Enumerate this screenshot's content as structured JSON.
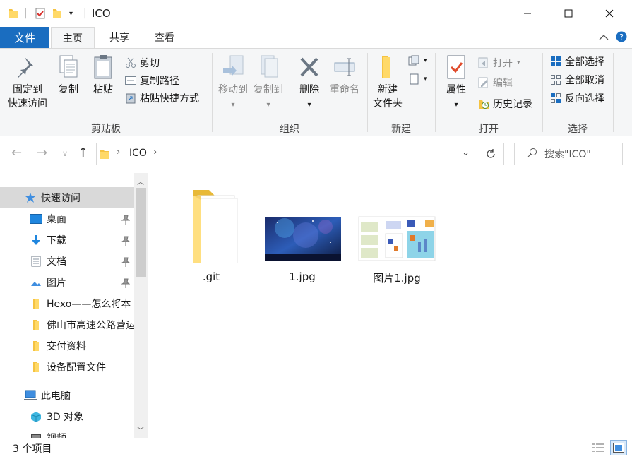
{
  "window": {
    "title": "ICO"
  },
  "ribbon_tabs": [
    "文件",
    "主页",
    "共享",
    "查看"
  ],
  "ribbon": {
    "clipboard": {
      "pin_label_1": "固定到",
      "pin_label_2": "快速访问",
      "copy": "复制",
      "paste": "粘贴",
      "cut": "剪切",
      "copy_path": "复制路径",
      "paste_shortcut": "粘贴快捷方式",
      "group": "剪贴板"
    },
    "organize": {
      "move_to": "移动到",
      "copy_to": "复制到",
      "delete": "删除",
      "rename": "重命名",
      "group": "组织"
    },
    "new": {
      "new_folder_1": "新建",
      "new_folder_2": "文件夹",
      "group": "新建"
    },
    "open": {
      "properties": "属性",
      "open": "打开",
      "edit": "编辑",
      "history": "历史记录",
      "group": "打开"
    },
    "select": {
      "select_all": "全部选择",
      "select_none": "全部取消",
      "invert": "反向选择",
      "group": "选择"
    }
  },
  "address": {
    "path": "ICO",
    "search_placeholder": "搜索\"ICO\""
  },
  "nav_pane": {
    "quick_access": "快速访问",
    "items": [
      {
        "label": "桌面",
        "pinned": true
      },
      {
        "label": "下载",
        "pinned": true
      },
      {
        "label": "文档",
        "pinned": true
      },
      {
        "label": "图片",
        "pinned": true
      },
      {
        "label": "Hexo——怎么将本",
        "pinned": false
      },
      {
        "label": "佛山市高速公路营运",
        "pinned": false
      },
      {
        "label": "交付资料",
        "pinned": false
      },
      {
        "label": "设备配置文件",
        "pinned": false
      }
    ],
    "this_pc": "此电脑",
    "pc_items": [
      "3D 对象",
      "视频"
    ]
  },
  "files": [
    {
      "name": ".git",
      "kind": "folder"
    },
    {
      "name": "1.jpg",
      "kind": "image-space"
    },
    {
      "name": "图片1.jpg",
      "kind": "image-diagram"
    }
  ],
  "status": {
    "count": "3 个项目"
  },
  "colors": {
    "accent": "#1a6dc0",
    "folder": "#f5c342",
    "selected": "#d9d9d9"
  }
}
